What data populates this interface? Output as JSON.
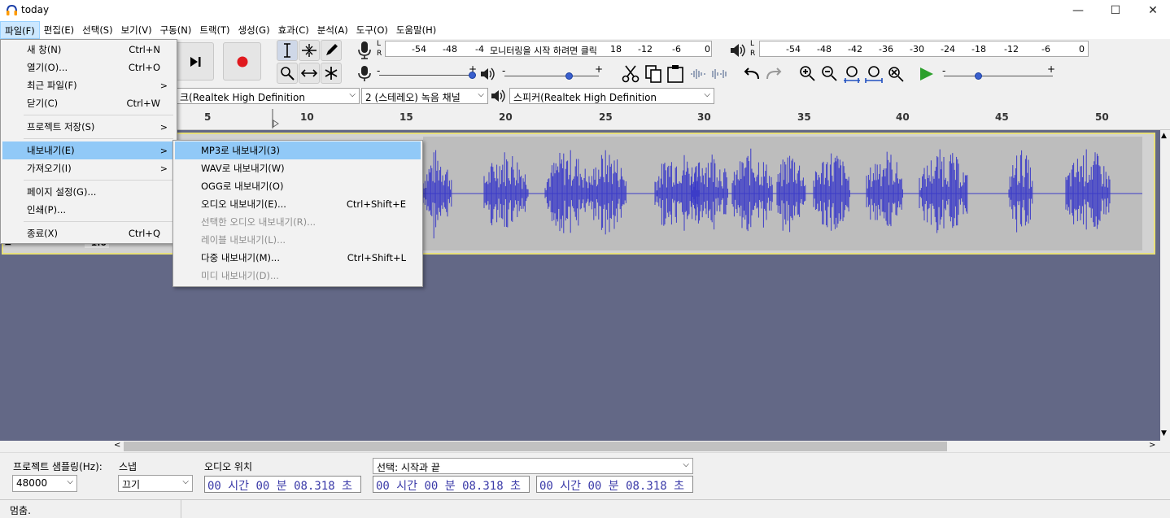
{
  "window": {
    "title": "today",
    "minimize": "—",
    "maximize": "☐",
    "close": "✕"
  },
  "menubar": [
    "파일(F)",
    "편집(E)",
    "선택(S)",
    "보기(V)",
    "구동(N)",
    "트랙(T)",
    "생성(G)",
    "효과(C)",
    "분석(A)",
    "도구(O)",
    "도움말(H)"
  ],
  "toolbar": {
    "record_meter_prompt": "모니터링을 시작 하려면 클릭",
    "record_ticks": [
      "-54",
      "-48",
      "-4",
      "18",
      "-12",
      "-6",
      "0"
    ],
    "play_ticks": [
      "-54",
      "-48",
      "-42",
      "-36",
      "-30",
      "-24",
      "-18",
      "-12",
      "-6",
      "0"
    ],
    "slider_minus": "-",
    "slider_plus": "+",
    "recording_device": "크(Realtek High Definition",
    "channels": "2 (스테레오) 녹음 채널",
    "playback_device": "스피커(Realtek High Definition"
  },
  "ruler": [
    "5",
    "10",
    "15",
    "20",
    "25",
    "30",
    "35",
    "40",
    "45",
    "50"
  ],
  "track": {
    "gain_label": "-1.0"
  },
  "file_menu": [
    {
      "label": "새 창(N)",
      "shortcut": "Ctrl+N"
    },
    {
      "label": "열기(O)...",
      "shortcut": "Ctrl+O"
    },
    {
      "label": "최근 파일(F)",
      "submenu": ">"
    },
    {
      "label": "닫기(C)",
      "shortcut": "Ctrl+W"
    },
    {
      "label": "프로젝트 저장(S)",
      "submenu": ">"
    },
    {
      "label": "내보내기(E)",
      "submenu": ">"
    },
    {
      "label": "가져오기(I)",
      "submenu": ">"
    },
    {
      "label": "페이지 설정(G)..."
    },
    {
      "label": "인쇄(P)..."
    },
    {
      "label": "종료(X)",
      "shortcut": "Ctrl+Q"
    }
  ],
  "export_submenu": [
    {
      "label": "MP3로 내보내기(3)"
    },
    {
      "label": "WAV로 내보내기(W)"
    },
    {
      "label": "OGG로 내보내기(O)"
    },
    {
      "label": "오디오 내보내기(E)...",
      "shortcut": "Ctrl+Shift+E"
    },
    {
      "label": "선택한 오디오 내보내기(R)..."
    },
    {
      "label": "레이블 내보내기(L)..."
    },
    {
      "label": "다중 내보내기(M)...",
      "shortcut": "Ctrl+Shift+L"
    },
    {
      "label": "미디 내보내기(D)..."
    }
  ],
  "bottom": {
    "rate_label": "프로젝트 샘플링(Hz):",
    "rate_value": "48000",
    "snap_label": "스냅",
    "snap_value": "끄기",
    "pos_label": "오디오 위치",
    "sel_label": "선택: 시작과 끝",
    "time1": "00 시간 00 분 08.318 초",
    "time2": "00 시간 00 분 08.318 초",
    "time3": "00 시간 00 분 08.318 초"
  },
  "status": {
    "text": "멈춤."
  }
}
